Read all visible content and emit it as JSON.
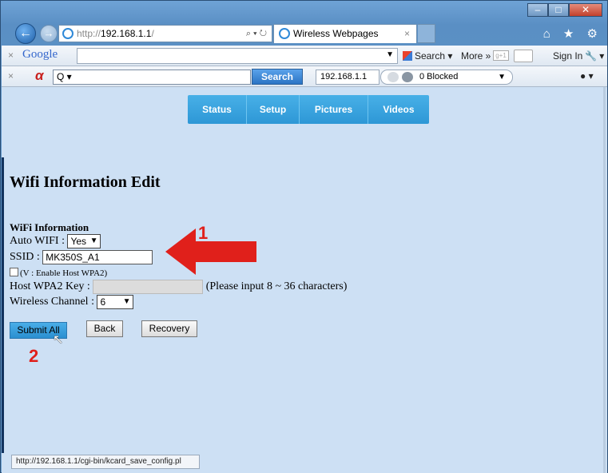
{
  "browser": {
    "address": {
      "prefix": "http://",
      "host": "192.168.1.1",
      "suffix": "/",
      "tools": "⌕ ▾ ↻"
    },
    "tab_title": "Wireless Webpages",
    "tab_close": "×",
    "nav_icons": "⌂ ★ ⚙",
    "window_buttons": {
      "minimize": "–",
      "maximize": "□",
      "close": "✕"
    }
  },
  "google_toolbar": {
    "close": "×",
    "logo": "Google",
    "search_label": "Search ▾",
    "more_label": "More »",
    "gplus": "g+1",
    "signin": "Sign In",
    "wrench": "🔧 ▾"
  },
  "ask_toolbar": {
    "close": "×",
    "logo": "α",
    "search_placeholder": "Q ▾",
    "search_button": "Search",
    "ip": "192.168.1.1",
    "blocked": "0 Blocked",
    "extra": "● ▾"
  },
  "menu": [
    "Status",
    "Setup",
    "Pictures",
    "Videos"
  ],
  "page": {
    "title": "Wifi Information Edit",
    "section": "WiFi Information",
    "auto_wifi_label": "Auto WIFI :",
    "auto_wifi_value": "Yes",
    "ssid_label": "SSID :",
    "ssid_value": "MK350S_A1",
    "wpa2_check_label": "(V : Enable Host WPA2)",
    "wpa2_key_label": "Host WPA2 Key :",
    "wpa2_hint": "(Please input 8 ~ 36 characters)",
    "channel_label": "Wireless Channel :",
    "channel_value": "6",
    "buttons": {
      "submit": "Submit All",
      "back": "Back",
      "recovery": "Recovery"
    }
  },
  "annotations": {
    "step1": "1",
    "step2": "2",
    "arrow_color": "#e0201b"
  },
  "status_url": "http://192.168.1.1/cgi-bin/kcard_save_config.pl",
  "colors": {
    "menu_bg": "#2d97d6",
    "page_bg": "#cde0f4",
    "primary_button": "#2a8fd0"
  }
}
